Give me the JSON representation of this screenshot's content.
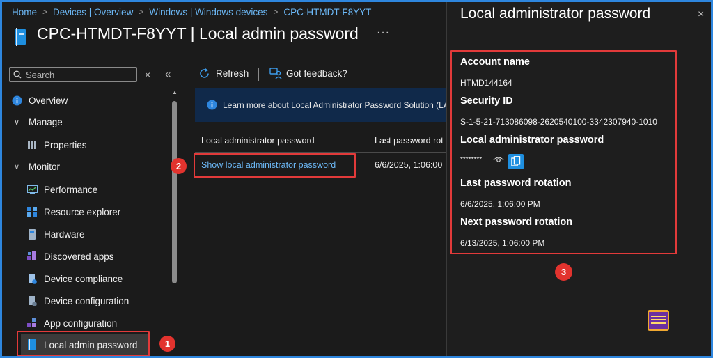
{
  "breadcrumb": [
    "Home",
    "Devices | Overview",
    "Windows | Windows devices",
    "CPC-HTMDT-F8YYT"
  ],
  "page": {
    "title": "CPC-HTMDT-F8YYT | Local admin password",
    "more": "···"
  },
  "sidebar": {
    "search_placeholder": "Search",
    "clear": "×",
    "collapse": "«",
    "items": {
      "overview": "Overview",
      "manage": "Manage",
      "properties": "Properties",
      "monitor": "Monitor",
      "performance": "Performance",
      "resource_explorer": "Resource explorer",
      "hardware": "Hardware",
      "discovered_apps": "Discovered apps",
      "device_compliance": "Device compliance",
      "device_configuration": "Device configuration",
      "app_configuration": "App configuration",
      "local_admin_password": "Local admin password"
    }
  },
  "toolbar": {
    "refresh": "Refresh",
    "feedback": "Got feedback?"
  },
  "banner": {
    "text": "Learn more about Local Administrator Password Solution (LA"
  },
  "table": {
    "columns": [
      "Local administrator password",
      "Last password rot"
    ],
    "row": {
      "link": "Show local administrator password",
      "date": "6/6/2025, 1:06:00"
    }
  },
  "panel": {
    "title": "Local administrator password",
    "close": "×",
    "account_name_label": "Account name",
    "account_name": "HTMD144164",
    "security_id_label": "Security ID",
    "security_id": "S-1-5-21-713086098-2620540100-3342307940-1010",
    "password_label": "Local administrator password",
    "password_mask": "********",
    "last_rotation_label": "Last password rotation",
    "last_rotation": "6/6/2025, 1:06:00 PM",
    "next_rotation_label": "Next password rotation",
    "next_rotation": "6/13/2025, 1:06:00 PM"
  },
  "badges": {
    "b1": "1",
    "b2": "2",
    "b3": "3"
  },
  "colors": {
    "link": "#6cb8f6",
    "accent": "#1e8fe0",
    "annotation": "#e23a3a",
    "banner": "#10294a"
  }
}
